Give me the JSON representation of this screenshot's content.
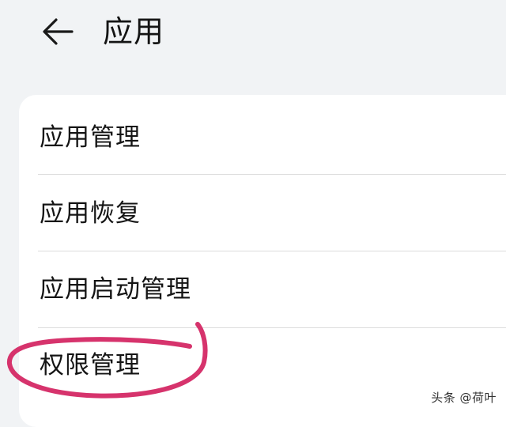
{
  "header": {
    "back_icon": "arrow-left-icon",
    "title": "应用"
  },
  "menu": {
    "items": [
      {
        "label": "应用管理"
      },
      {
        "label": "应用恢复"
      },
      {
        "label": "应用启动管理"
      },
      {
        "label": "权限管理",
        "highlighted": true
      }
    ]
  },
  "annotation": {
    "shape": "hand-drawn-circle",
    "color": "#d6336c"
  },
  "watermark": {
    "text": "头条 @荷叶"
  }
}
